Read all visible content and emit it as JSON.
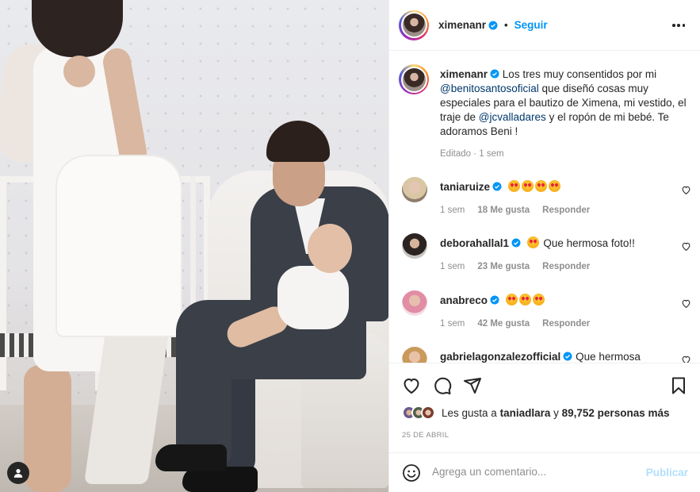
{
  "post": {
    "author": {
      "username": "ximenanr",
      "follow_label": "Seguir",
      "separator": "•"
    }
  },
  "caption": {
    "username": "ximenanr",
    "text_1": "Los tres muy consentidos por mi",
    "mention_1": "@benitosantosoficial",
    "text_2": "que diseñó cosas muy especiales para el bautizo de Ximena, mi vestido, el traje de",
    "mention_2": "@jcvalladares",
    "text_3": "y el ropón de mi bebé. Te adoramos Beni !",
    "meta": "Editado · 1 sem"
  },
  "comments": [
    {
      "username": "taniaruize",
      "text": "",
      "emoji_count": 4,
      "time": "1 sem",
      "likes": "18 Me gusta",
      "reply": "Responder"
    },
    {
      "username": "deborahallal1",
      "text": "Que hermosa foto!!",
      "emoji_count": 1,
      "time": "1 sem",
      "likes": "23 Me gusta",
      "reply": "Responder"
    },
    {
      "username": "anabreco",
      "text": "",
      "emoji_count": 3,
      "time": "1 sem",
      "likes": "42 Me gusta",
      "reply": "Responder"
    },
    {
      "username": "gabrielagonzalezofficial",
      "text": "Que hermosa",
      "emoji_count": 0,
      "time": "",
      "likes": "",
      "reply": ""
    }
  ],
  "likes": {
    "prefix": "Les gusta a",
    "user": "taniadlara",
    "connector": "y",
    "count": "89,752 personas más"
  },
  "date": "25 DE ABRIL",
  "comment_box": {
    "placeholder": "Agrega un comentario...",
    "publish_label": "Publicar"
  },
  "colors": {
    "accent": "#0095f6",
    "publish_disabled": "#b2dffc",
    "mention": "#00376b",
    "muted": "#8e8e8e"
  },
  "icons": [
    "more-options-icon",
    "verified-badge-icon",
    "heart-icon",
    "comment-icon",
    "share-icon",
    "save-icon",
    "emoji-icon",
    "user-tag-icon"
  ]
}
